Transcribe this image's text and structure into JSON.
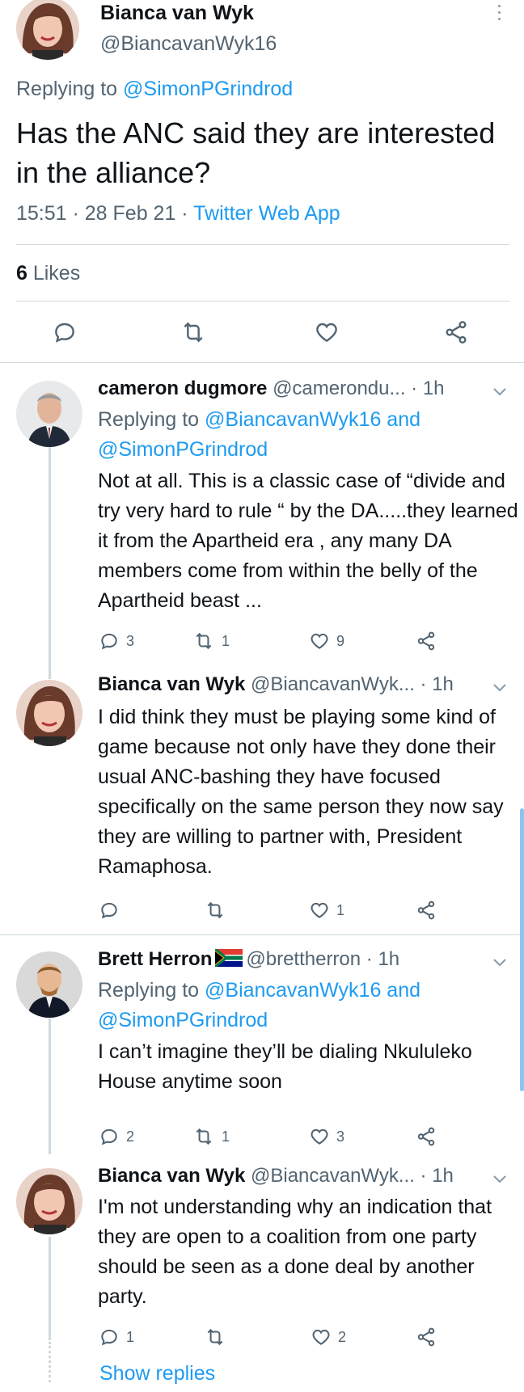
{
  "main_tweet": {
    "name": "Bianca van Wyk",
    "handle": "@BiancavanWyk16",
    "replying_prefix": "Replying to ",
    "replying_to": "@SimonPGrindrod",
    "text": "Has the ANC said they are interested in the alliance?",
    "time": "15:51 · 28 Feb 21 · ",
    "source": "Twitter Web App",
    "likes_count": "6",
    "likes_label": " Likes"
  },
  "replies": [
    {
      "name": "cameron dugmore",
      "handle": "@camerondu...",
      "time": "· 1h",
      "replying_prefix": "Replying to ",
      "replying_to_1": "@BiancavanWyk16",
      "replying_and": " and",
      "replying_to_2": "@SimonPGrindrod",
      "text": "Not at all. This is a classic case of “divide and try very hard to rule “ by the DA.....they learned it from the Apartheid era , any many DA members come from within the belly of the Apartheid beast ...",
      "replies": "3",
      "retweets": "1",
      "likes": "9"
    },
    {
      "name": "Bianca van Wyk",
      "handle": "@BiancavanWyk...",
      "time": "· 1h",
      "text": "I did think they must be playing some kind of game because not only have they done their usual ANC-bashing they have focused specifically on the same person they now say they are willing to partner with, President Ramaphosa.",
      "replies": "",
      "retweets": "",
      "likes": "1"
    },
    {
      "name": "Brett Herron",
      "handle": "@brettherron",
      "time": "· 1h",
      "replying_prefix": "Replying to ",
      "replying_to_1": "@BiancavanWyk16",
      "replying_and": " and",
      "replying_to_2": "@SimonPGrindrod",
      "text": "I can’t imagine they’ll be dialing Nkululeko House anytime soon",
      "replies": "2",
      "retweets": "1",
      "likes": "3"
    },
    {
      "name": "Bianca van Wyk",
      "handle": "@BiancavanWyk...",
      "time": "· 1h",
      "text": "I'm not understanding why an indication that they are open to a coalition from one party should be seen as a done deal by another party.",
      "replies": "1",
      "retweets": "",
      "likes": "2"
    }
  ],
  "show_replies": "Show replies",
  "icons": [
    "more-vertical-icon",
    "reply-icon",
    "retweet-icon",
    "like-icon",
    "share-icon",
    "chevron-down-icon",
    "south-africa-flag-icon"
  ],
  "colors": {
    "link": "#1d9bf0",
    "secondary": "#536471",
    "text": "#0f1419",
    "divider": "#cfd9de"
  }
}
